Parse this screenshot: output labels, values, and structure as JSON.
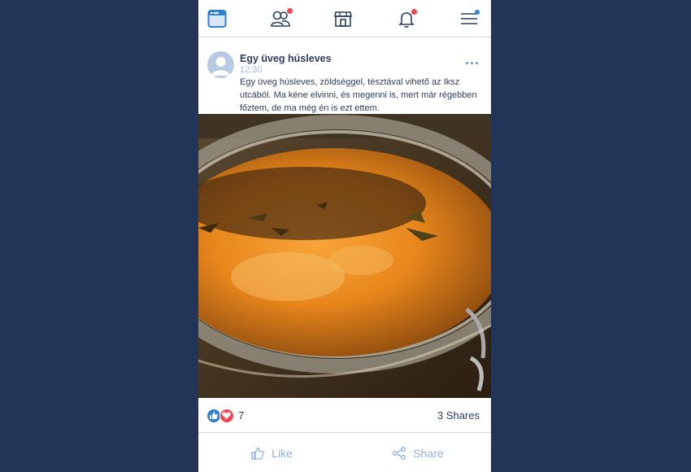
{
  "nav": {
    "items": [
      {
        "icon": "browser-window-icon"
      },
      {
        "icon": "friends-icon",
        "badge_color": "#f1464f"
      },
      {
        "icon": "marketplace-icon"
      },
      {
        "icon": "bell-icon",
        "badge_color": "#f1464f"
      },
      {
        "icon": "menu-icon",
        "badge_color": "#2f7fd7"
      }
    ]
  },
  "post": {
    "author": "Egy üveg húsleves",
    "time": "12:30",
    "text": "Egy üveg húsleves, zöldséggel, tésztával vihető az Iksz utcából. Ma kéne elvinni, és megenni is, mert már régebben főztem, de ma még én is ezt ettem.",
    "more_icon": "more-dots-icon",
    "image_icon": "soup-jar-photo"
  },
  "reactions": {
    "count": "7",
    "shares": "3 Shares",
    "like_color": "#2f7fd7",
    "love_color": "#f1464f"
  },
  "actions": {
    "like_label": "Like",
    "share_label": "Share"
  },
  "colors": {
    "background": "#223458",
    "text": "#2c3e5c",
    "accent": "#2f7fd7",
    "muted": "#8fb1dd"
  }
}
